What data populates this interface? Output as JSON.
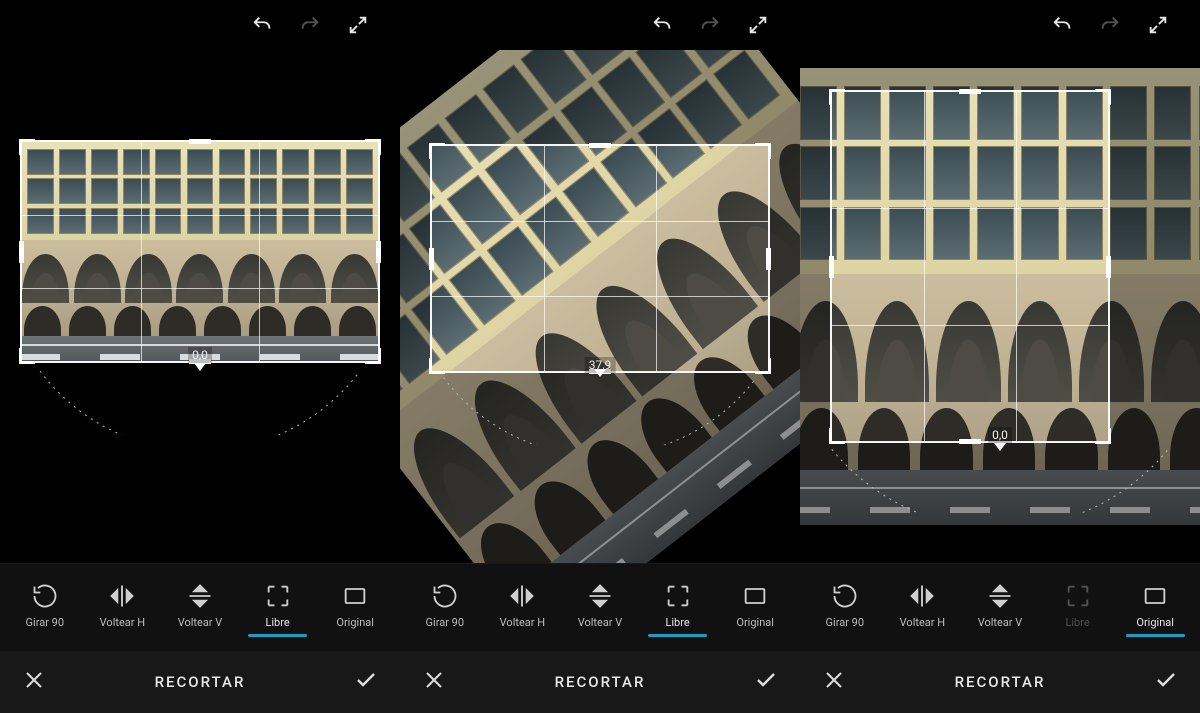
{
  "panels": [
    {
      "angle": "0,0",
      "tools": [
        {
          "label": "Girar 90",
          "selected": false
        },
        {
          "label": "Voltear H",
          "selected": false
        },
        {
          "label": "Voltear V",
          "selected": false
        },
        {
          "label": "Libre",
          "selected": true
        },
        {
          "label": "Original",
          "selected": false
        }
      ],
      "action_title": "RECORTAR"
    },
    {
      "angle": "37,9",
      "tools": [
        {
          "label": "Girar 90",
          "selected": false
        },
        {
          "label": "Voltear H",
          "selected": false
        },
        {
          "label": "Voltear V",
          "selected": false
        },
        {
          "label": "Libre",
          "selected": true
        },
        {
          "label": "Original",
          "selected": false
        }
      ],
      "action_title": "RECORTAR"
    },
    {
      "angle": "0,0",
      "tools": [
        {
          "label": "Girar 90",
          "selected": false
        },
        {
          "label": "Voltear H",
          "selected": false
        },
        {
          "label": "Voltear V",
          "selected": false
        },
        {
          "label": "Libre",
          "selected": false,
          "dim": true
        },
        {
          "label": "Original",
          "selected": true
        }
      ],
      "action_title": "RECORTAR"
    }
  ]
}
